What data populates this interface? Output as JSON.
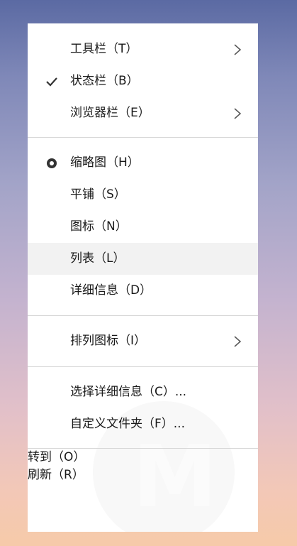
{
  "menu": {
    "items": [
      {
        "label": "工具栏（T）",
        "mark": "",
        "submenu": true
      },
      {
        "label": "状态栏（B）",
        "mark": "check-icon",
        "submenu": false
      },
      {
        "label": "浏览器栏（E）",
        "mark": "",
        "submenu": true
      },
      {
        "label": "缩略图（H）",
        "mark": "radio-selected-icon",
        "submenu": false
      },
      {
        "label": "平铺（S）",
        "mark": "",
        "submenu": false
      },
      {
        "label": "图标（N）",
        "mark": "",
        "submenu": false
      },
      {
        "label": "列表（L）",
        "mark": "",
        "submenu": false,
        "highlighted": true
      },
      {
        "label": "详细信息（D）",
        "mark": "",
        "submenu": false
      },
      {
        "label": "排列图标（I）",
        "mark": "",
        "submenu": true
      },
      {
        "label": "选择详细信息（C）...",
        "mark": "",
        "submenu": false
      },
      {
        "label": "自定义文件夹（F）...",
        "mark": "",
        "submenu": false
      },
      {
        "label": "转到（O）",
        "mark": "",
        "submenu": false
      },
      {
        "label": "刷新（R）",
        "mark": "",
        "submenu": false
      }
    ]
  },
  "colors": {
    "menu_bg": "#ffffff",
    "hover_bg": "#f2f2f2",
    "separator": "#d7d7d7",
    "text": "#1a1a1a"
  }
}
